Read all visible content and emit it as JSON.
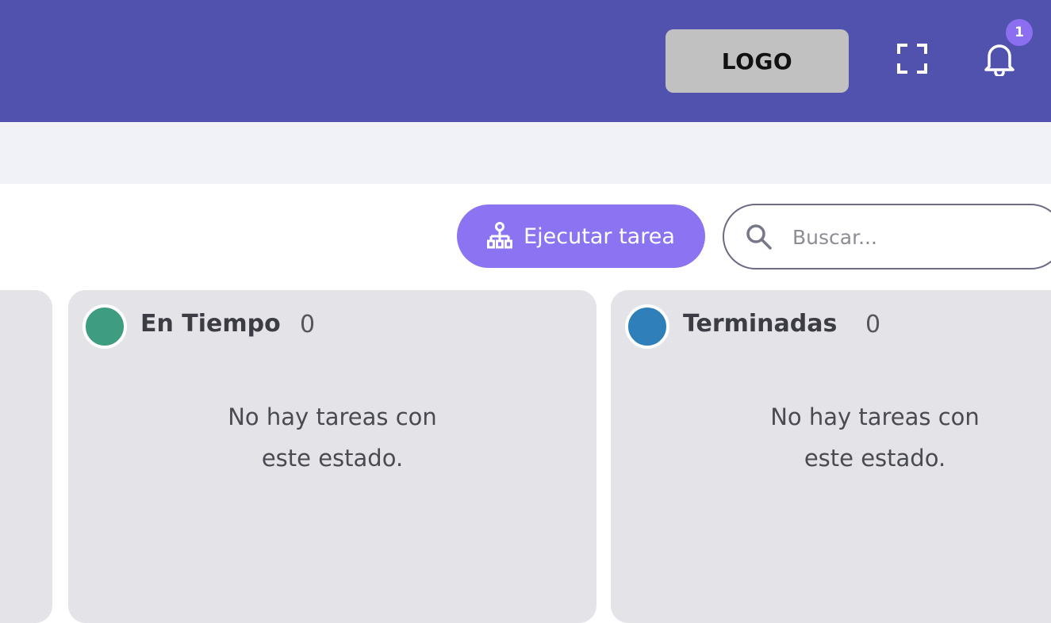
{
  "header": {
    "logo_text": "LOGO",
    "fullscreen_icon": "fullscreen-icon",
    "notifications_icon": "bell-icon",
    "notification_count": "1",
    "background_color": "#5052ad"
  },
  "toolbar": {
    "run_task_label": "Ejecutar tarea",
    "run_task_icon": "sitemap-icon",
    "run_task_color": "#8c73f2",
    "search_placeholder": "Buscar...",
    "search_value": ""
  },
  "columns": [
    {
      "title": "En Tiempo",
      "count": "0",
      "dot_color": "#3e9c80",
      "empty_message_line1": "No hay tareas con",
      "empty_message_line2": "este estado."
    },
    {
      "title": "Terminadas",
      "count": "0",
      "dot_color": "#2e7fba",
      "empty_message_line1": "No hay tareas con",
      "empty_message_line2": "este estado."
    }
  ]
}
